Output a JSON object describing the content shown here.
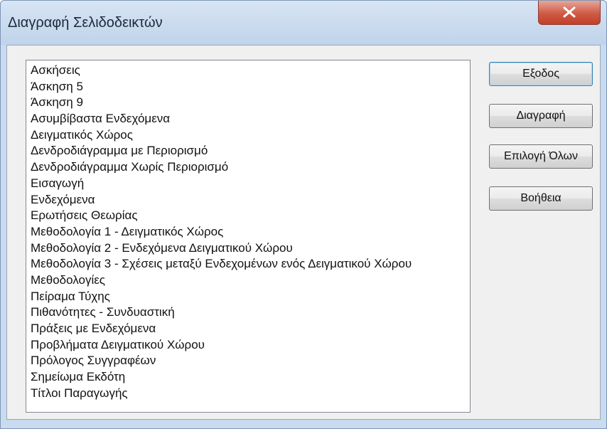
{
  "window": {
    "title": "Διαγραφή Σελιδοδεικτών",
    "close_icon": "close-x-icon"
  },
  "bookmarks": [
    "Ασκήσεις",
    "Άσκηση  5",
    "Άσκηση  9",
    "Ασυμβίβαστα Ενδεχόμενα",
    "Δειγματικός Χώρος",
    "Δενδροδιάγραμμα με Περιορισμό",
    "Δενδροδιάγραμμα Χωρίς Περιορισμό",
    "Εισαγωγή",
    "Ενδεχόμενα",
    "Ερωτήσεις Θεωρίας",
    "Μεθοδολογία 1 - Δειγματικός Χώρος",
    "Μεθοδολογία 2 - Ενδεχόμενα Δειγματικού Χώρου",
    "Μεθοδολογία 3 - Σχέσεις μεταξύ Ενδεχομένων ενός Δειγματικού Χώρου",
    "Μεθοδολογίες",
    "Πείραμα Τύχης",
    "Πιθανότητες - Συνδυαστική",
    "Πράξεις με Ενδεχόμενα",
    "Προβλήματα Δειγματικού Χώρου",
    "Πρόλογος Συγγραφέων",
    "Σημείωμα Εκδότη",
    "Τίτλοι Παραγωγής"
  ],
  "buttons": {
    "exit": "Εξοδος",
    "delete": "Διαγραφή",
    "select_all": "Επιλογή Όλων",
    "help": "Βοήθεια"
  },
  "colors": {
    "frame": "#c9dbee",
    "close_button": "#cf5a45",
    "client": "#f0f0f0"
  }
}
